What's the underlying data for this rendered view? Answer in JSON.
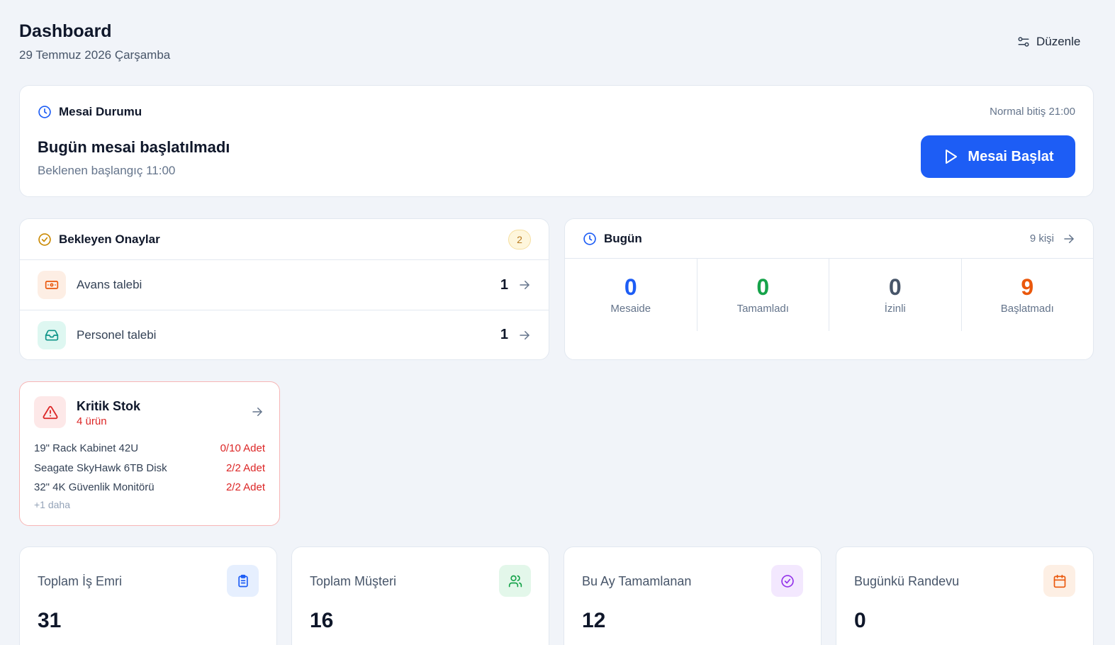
{
  "header": {
    "title": "Dashboard",
    "date": "29 Temmuz 2026 Çarşamba",
    "edit_label": "Düzenle"
  },
  "shift": {
    "title": "Mesai Durumu",
    "normal_end": "Normal bitiş 21:00",
    "status": "Bugün mesai başlatılmadı",
    "expected_start": "Beklenen başlangıç 11:00",
    "start_button": "Mesai Başlat"
  },
  "approvals": {
    "title": "Bekleyen Onaylar",
    "badge": "2",
    "items": [
      {
        "label": "Avans talebi",
        "count": "1",
        "icon": "money-icon",
        "color": "#ea580c"
      },
      {
        "label": "Personel talebi",
        "count": "1",
        "icon": "inbox-icon",
        "color": "#0d9488"
      }
    ]
  },
  "today": {
    "title": "Bugün",
    "people": "9 kişi",
    "stats": [
      {
        "value": "0",
        "label": "Mesaide",
        "color": "#1d5df5"
      },
      {
        "value": "0",
        "label": "Tamamladı",
        "color": "#16a34a"
      },
      {
        "value": "0",
        "label": "İzinli",
        "color": "#475569"
      },
      {
        "value": "9",
        "label": "Başlatmadı",
        "color": "#ea580c"
      }
    ]
  },
  "critical_stock": {
    "title": "Kritik Stok",
    "count": "4 ürün",
    "items": [
      {
        "name": "19\" Rack Kabinet 42U",
        "qty": "0/10 Adet"
      },
      {
        "name": "Seagate SkyHawk 6TB Disk",
        "qty": "2/2 Adet"
      },
      {
        "name": "32\" 4K Güvenlik Monitörü",
        "qty": "2/2 Adet"
      }
    ],
    "more": "+1 daha"
  },
  "summary": [
    {
      "label": "Toplam İş Emri",
      "value": "31",
      "icon": "clipboard-icon",
      "color": "#1d5df5",
      "bg": "#e6effe"
    },
    {
      "label": "Toplam Müşteri",
      "value": "16",
      "icon": "users-icon",
      "color": "#16a34a",
      "bg": "#e3f7ea"
    },
    {
      "label": "Bu Ay Tamamlanan",
      "value": "12",
      "icon": "check-circle-icon",
      "color": "#9333ea",
      "bg": "#f3e8fe"
    },
    {
      "label": "Bugünkü Randevu",
      "value": "0",
      "icon": "calendar-icon",
      "color": "#ea580c",
      "bg": "#fdefe4"
    }
  ]
}
